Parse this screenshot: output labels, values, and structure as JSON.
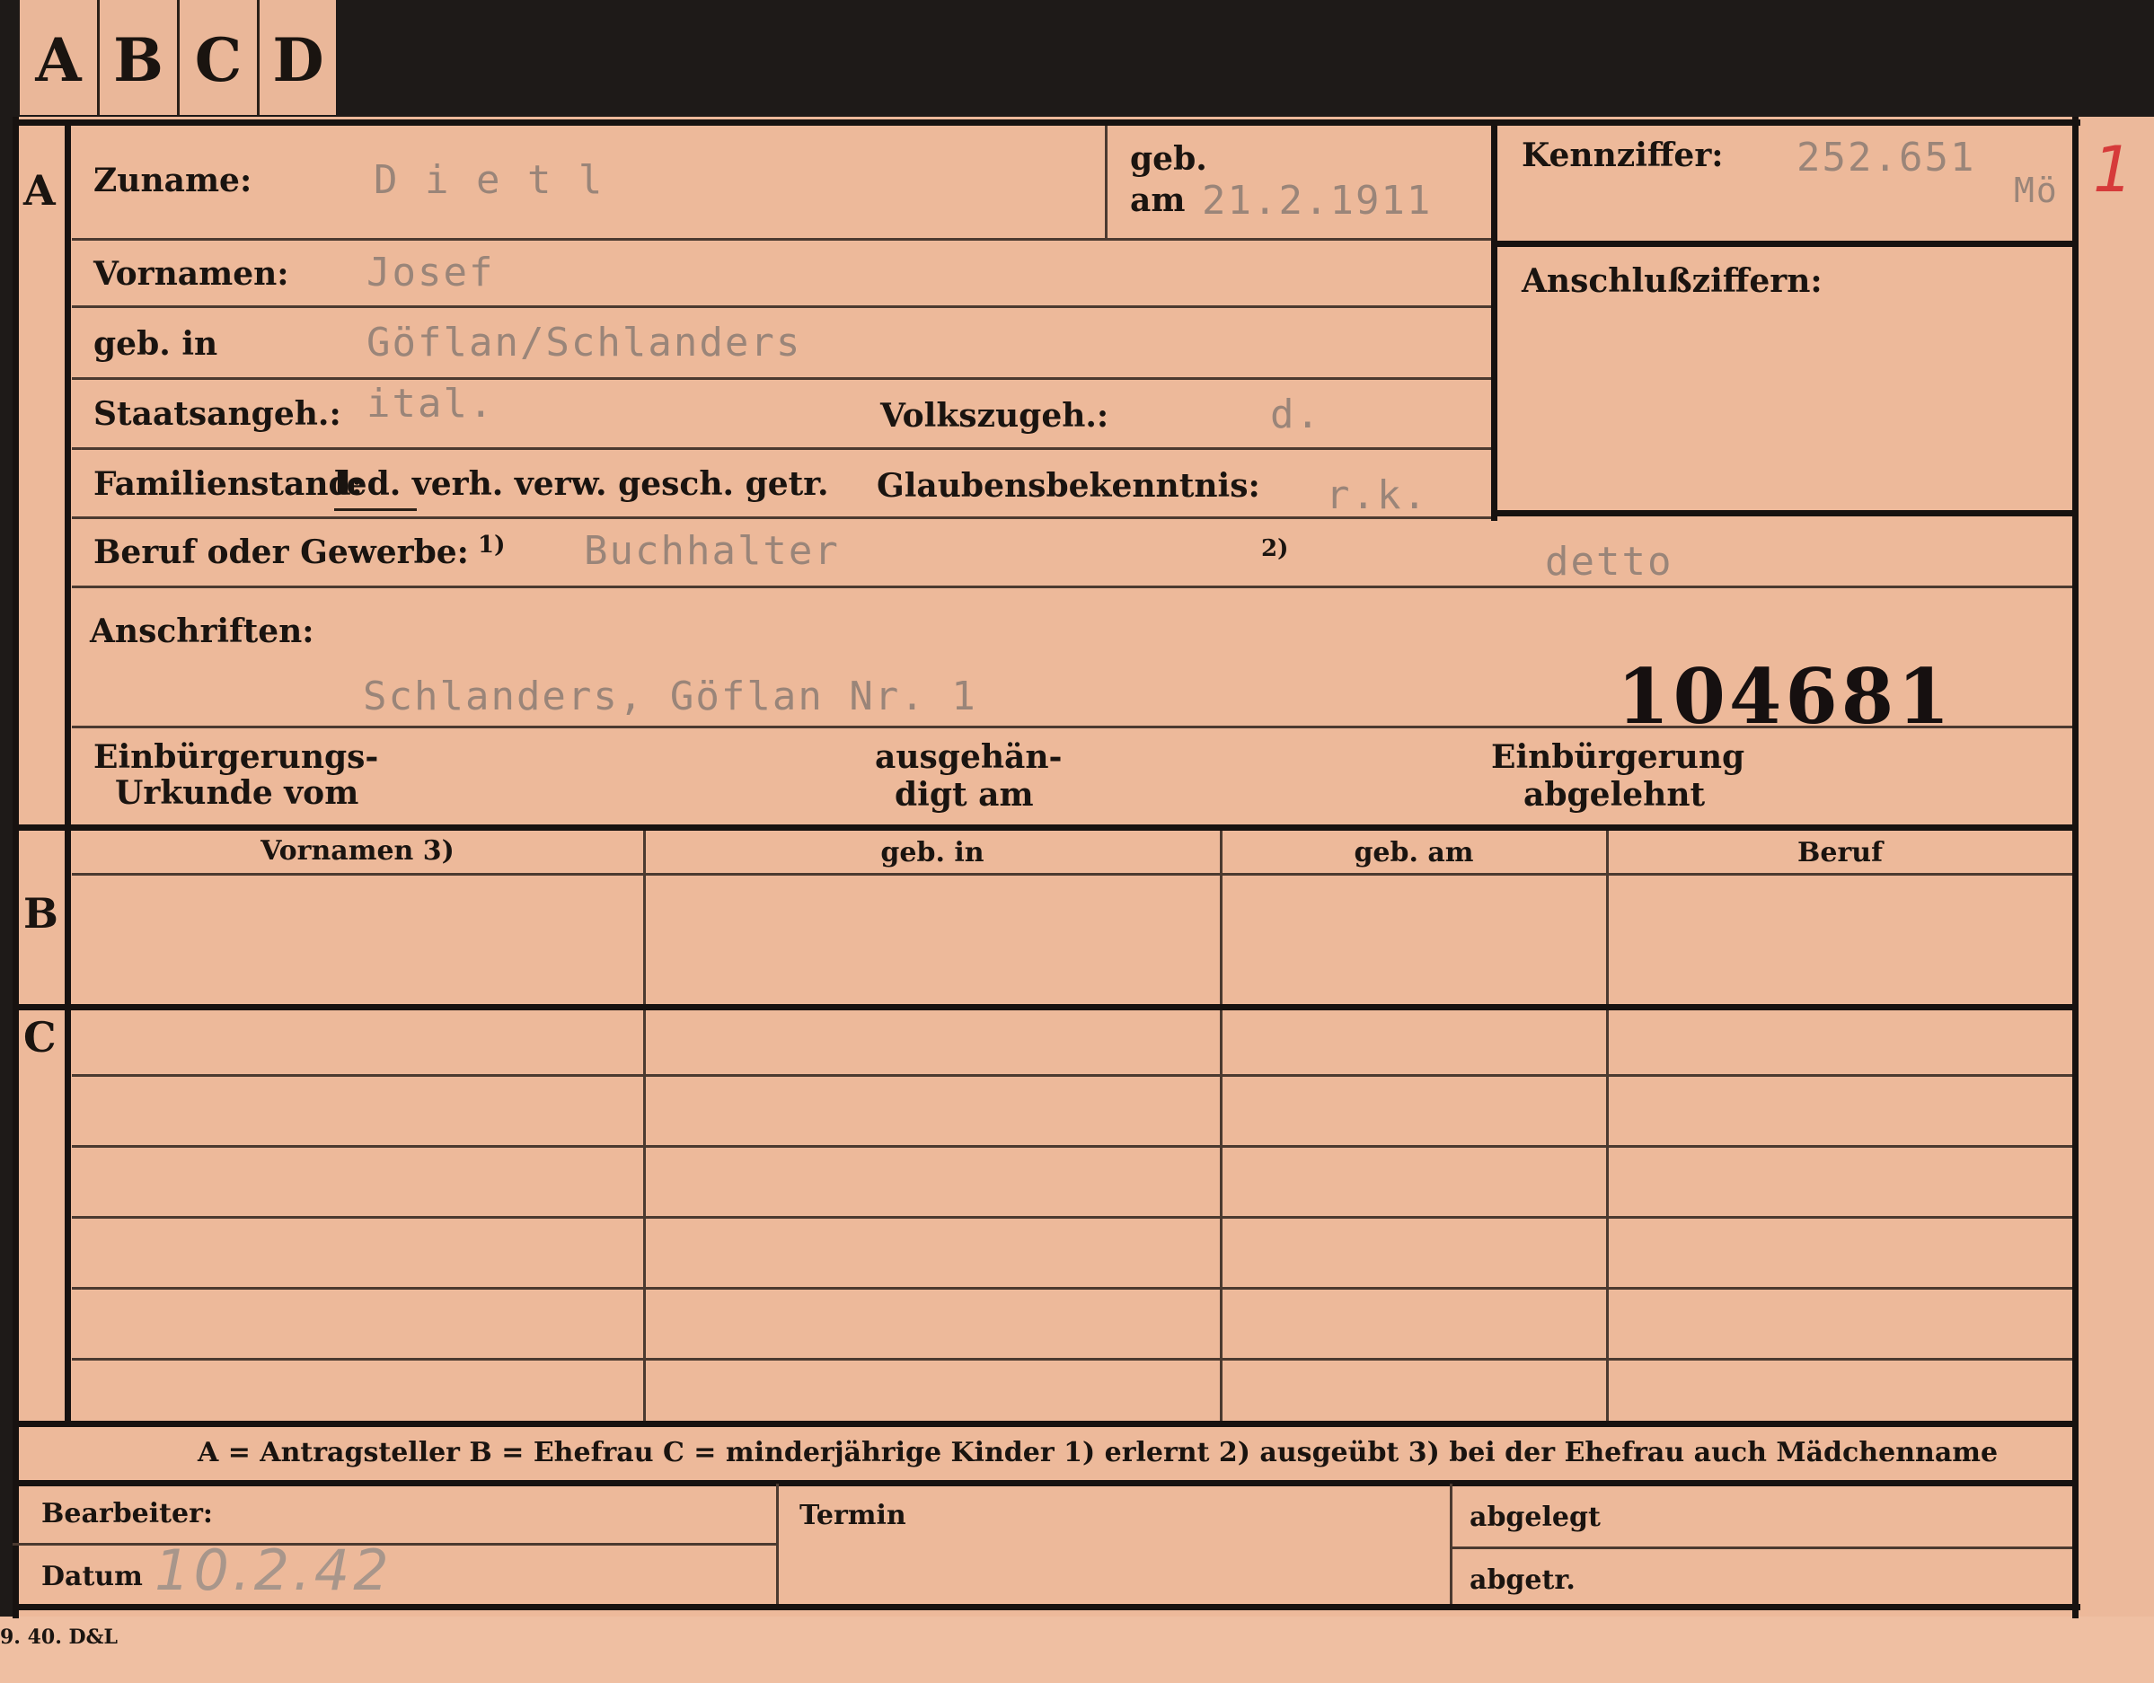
{
  "tabs": [
    "A",
    "B",
    "C",
    "D"
  ],
  "sections": {
    "a": "A",
    "b": "B",
    "c": "C"
  },
  "labels": {
    "zuname": "Zuname:",
    "geb": "geb.",
    "am": "am",
    "kennziffer": "Kennziffer:",
    "anschlussziffern": "Anschlußziffern:",
    "vornamen": "Vornamen:",
    "geb_in": "geb. in",
    "staatsangeh": "Staatsangeh.:",
    "volkszugeh": "Volkszugeh.:",
    "familienstand": "Familienstand:",
    "familienstand_options": "led. verh. verw. gesch. getr.",
    "glaubensbekenntnis": "Glaubensbekenntnis:",
    "beruf": "Beruf oder Gewerbe:",
    "beruf_note1": "1)",
    "beruf_note2": "2)",
    "anschriften": "Anschriften:",
    "einbuergerungs_line1": "Einbürgerungs-",
    "einbuergerungs_line2": "Urkunde vom",
    "ausgehaen_line1": "ausgehän-",
    "ausgehaen_line2": "digt am",
    "einbuergerung_line1": "Einbürgerung",
    "einbuergerung_line2": "abgelehnt"
  },
  "values": {
    "zuname": "D i e t l",
    "geb_am": "21.2.1911",
    "kennziffer": "252.651",
    "kennziffer_suffix": "Mö",
    "vornamen": "Josef",
    "geb_in": "Göflan/Schlanders",
    "staatsangeh": "ital.",
    "volkszugeh": "d.",
    "glaubensbekenntnis": "r.k.",
    "beruf_erlernt": "Buchhalter",
    "beruf_ausgeuebt": "detto",
    "anschrift": "Schlanders, Göflan Nr. 1",
    "stamp_number": "104681",
    "corner_mark": "1"
  },
  "table": {
    "headers": [
      "Vornamen 3)",
      "geb. in",
      "geb. am",
      "Beruf"
    ]
  },
  "legend": "A = Antragsteller    B = Ehefrau    C = minderjährige Kinder    1) erlernt    2) ausgeübt    3) bei der Ehefrau auch Mädchenname",
  "footer": {
    "bearbeiter": "Bearbeiter:",
    "termin": "Termin",
    "abgelegt": "abgelegt",
    "datum": "Datum",
    "datum_value": "10.2.42",
    "abgetr": "abgetr."
  },
  "print_code": "9. 40. D&L"
}
